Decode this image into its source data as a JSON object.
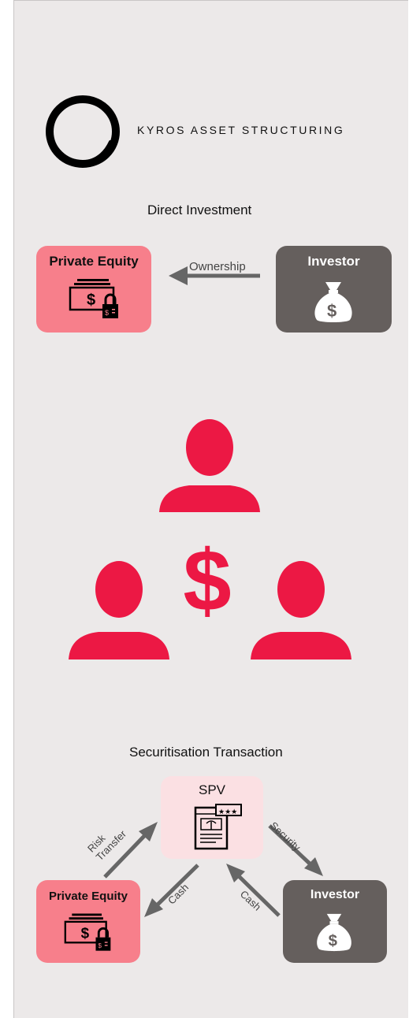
{
  "brand": {
    "name": "KYROS ASSET STRUCTURING",
    "logo_icon": "brush-circle-icon"
  },
  "direct_investment": {
    "title": "Direct Investment",
    "private_equity_label": "Private Equity",
    "investor_label": "Investor",
    "arrow_label": "Ownership",
    "private_equity_icon": "locked-cash-icon",
    "investor_icon": "money-bag-icon"
  },
  "network_illustration": {
    "icons": [
      "person-icon",
      "person-icon",
      "person-icon",
      "dollar-sign-icon"
    ]
  },
  "securitisation": {
    "title": "Securitisation Transaction",
    "spv_label": "SPV",
    "private_equity_label": "Private Equity",
    "investor_label": "Investor",
    "arrow_risk_transfer": "Risk Transfer",
    "arrow_security": "Security",
    "arrow_cash_left": "Cash",
    "arrow_cash_right": "Cash",
    "spv_icon": "document-rating-icon"
  },
  "colors": {
    "background": "#ece9e9",
    "private_equity_fill": "#f77f8b",
    "investor_fill": "#655f5d",
    "spv_fill": "#fbe0e3",
    "accent_red": "#ec1844",
    "arrow": "#666666"
  }
}
